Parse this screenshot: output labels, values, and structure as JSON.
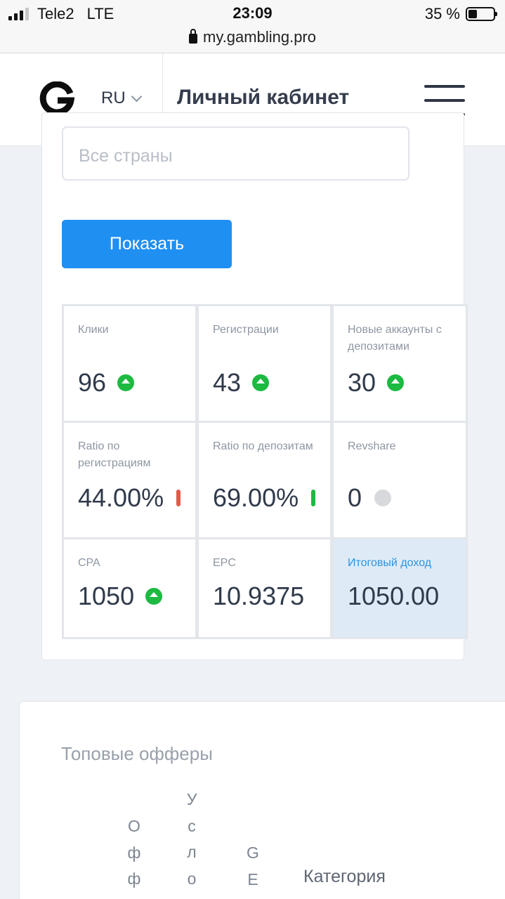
{
  "status_bar": {
    "carrier": "Tele2",
    "network": "LTE",
    "time": "23:09",
    "battery": "35 %",
    "url": "my.gambling.pro"
  },
  "header": {
    "logo_letter": "G",
    "language": "RU",
    "title": "Личный кабинет"
  },
  "filters": {
    "country_placeholder": "Все страны",
    "show_button": "Показать"
  },
  "stats": [
    {
      "label": "Клики",
      "value": "96",
      "indicator": "up"
    },
    {
      "label": "Регистрации",
      "value": "43",
      "indicator": "up"
    },
    {
      "label": "Новые аккаунты с депозитами",
      "value": "30",
      "indicator": "up"
    },
    {
      "label": "Ratio по регистрациям",
      "value": "44.00%",
      "indicator": "red-bar"
    },
    {
      "label": "Ratio по депозитам",
      "value": "69.00%",
      "indicator": "green-bar"
    },
    {
      "label": "Revshare",
      "value": "0",
      "indicator": "neutral"
    },
    {
      "label": "CPA",
      "value": "1050",
      "indicator": "up"
    },
    {
      "label": "EPC",
      "value": "10.9375",
      "indicator": "none"
    },
    {
      "label": "Итоговый доход",
      "value": "1050.00",
      "indicator": "none",
      "highlight": true
    }
  ],
  "top_offers": {
    "title": "Топовые офферы",
    "col_offer": [
      "О",
      "ф",
      "ф"
    ],
    "col_terms": [
      "У",
      "с",
      "л",
      "о"
    ],
    "col_geo": [
      "G",
      "E"
    ],
    "col_category": "Категория"
  },
  "colors": {
    "primary": "#1f8ff2",
    "up": "#1dba41",
    "down": "#e05a4a",
    "highlight_bg": "#deebf7"
  }
}
